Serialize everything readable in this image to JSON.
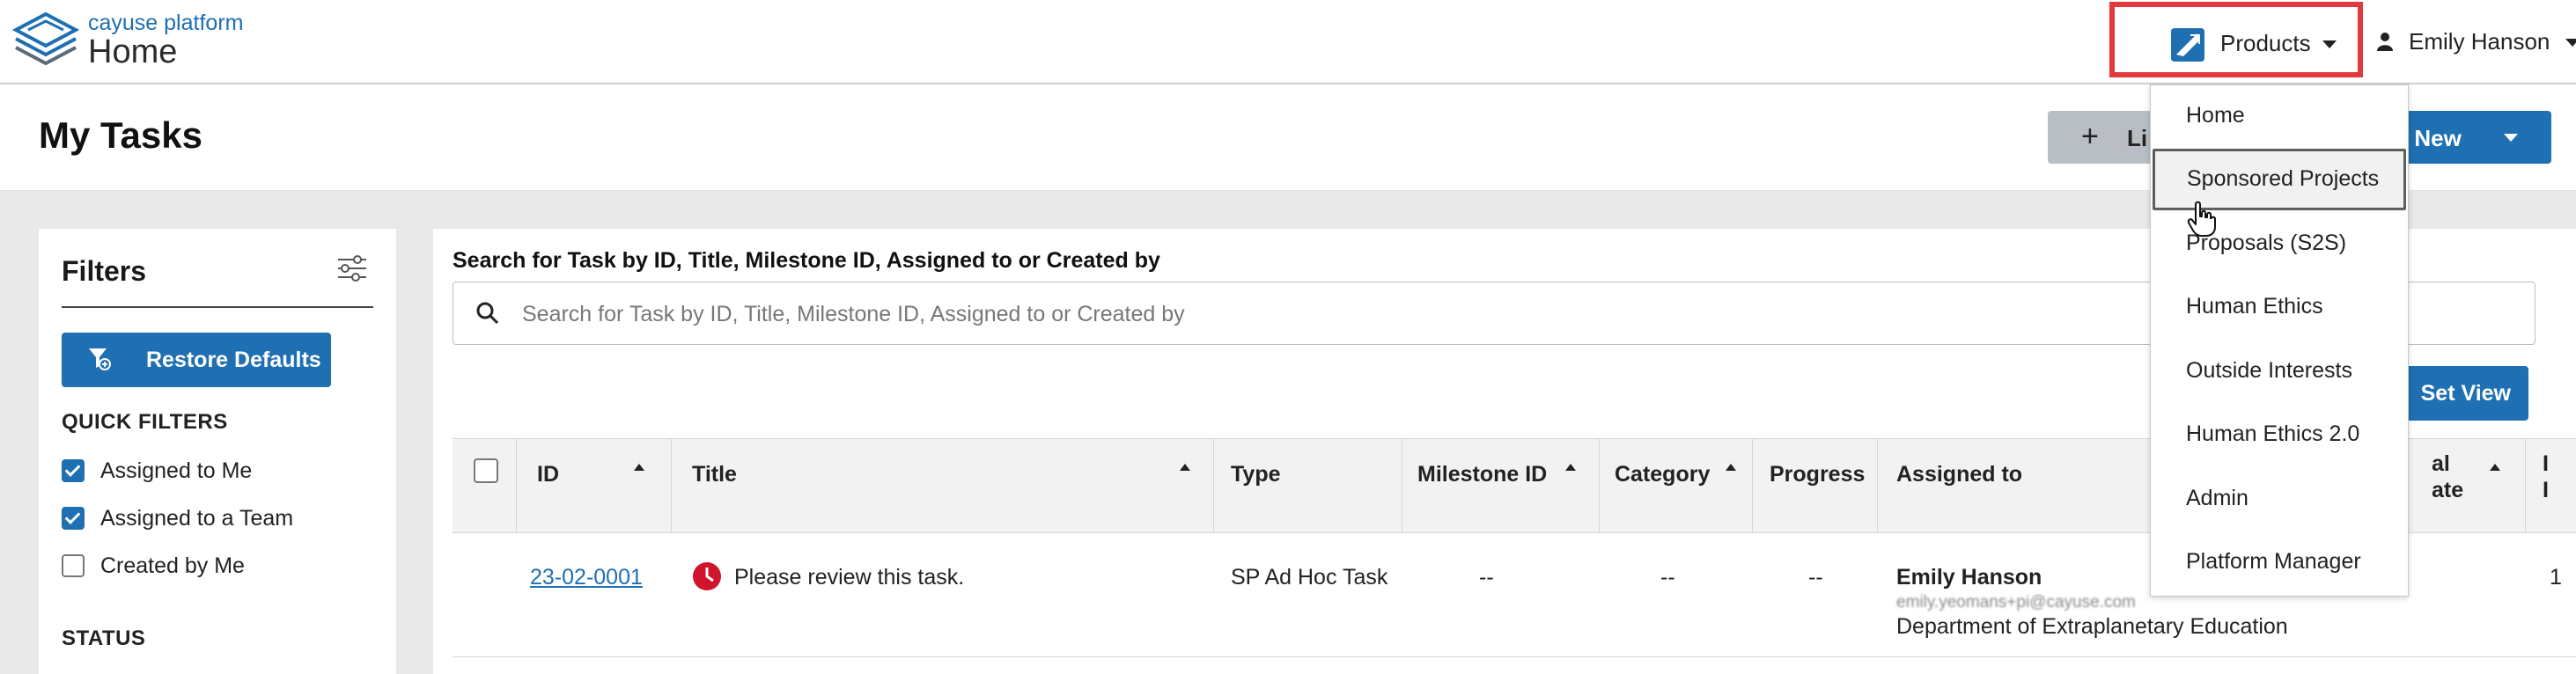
{
  "app": {
    "brand": "cayuse platform",
    "title": "Home",
    "colors": {
      "accent": "#1f6fb3",
      "highlight": "#e0393e",
      "clock": "#d0142b"
    }
  },
  "topbar": {
    "products_label": "Products",
    "products_icon": "products-logo-icon",
    "user_name": "Emily Hanson",
    "user_icon": "person-icon"
  },
  "header": {
    "page_title": "My Tasks",
    "link_label": "Li",
    "create_label": "te New"
  },
  "filters": {
    "title": "Filters",
    "restore_label": "Restore Defaults",
    "quick_filters_heading": "QUICK FILTERS",
    "quick_filters": [
      {
        "label": "Assigned to Me",
        "checked": true
      },
      {
        "label": "Assigned to a Team",
        "checked": true
      },
      {
        "label": "Created by Me",
        "checked": false
      }
    ],
    "status_heading": "STATUS"
  },
  "search": {
    "label": "Search for Task by ID, Title, Milestone ID, Assigned to or Created by",
    "placeholder": "Search for Task by ID, Title, Milestone ID, Assigned to or Created by",
    "value": ""
  },
  "set_view_label": "Set View",
  "table": {
    "columns": [
      "ID",
      "Title",
      "Type",
      "Milestone ID",
      "Category",
      "Progress",
      "Assigned to",
      "al",
      "ate",
      "I",
      "I"
    ],
    "rows": [
      {
        "id": "23-02-0001",
        "title": "Please review this task.",
        "type": "SP Ad Hoc Task",
        "milestone_id": "--",
        "category": "--",
        "progress": "--",
        "assigned_name": "Emily Hanson",
        "assigned_email": "emily.yeomans+pi@cayuse.com",
        "assigned_dept": "Department of Extraplanetary Education",
        "trailing": "1"
      }
    ]
  },
  "products_menu": {
    "items": [
      "Home",
      "Sponsored Projects",
      "Proposals (S2S)",
      "Human Ethics",
      "Outside Interests",
      "Human Ethics 2.0",
      "Admin",
      "Platform Manager"
    ],
    "active": "Sponsored Projects"
  }
}
